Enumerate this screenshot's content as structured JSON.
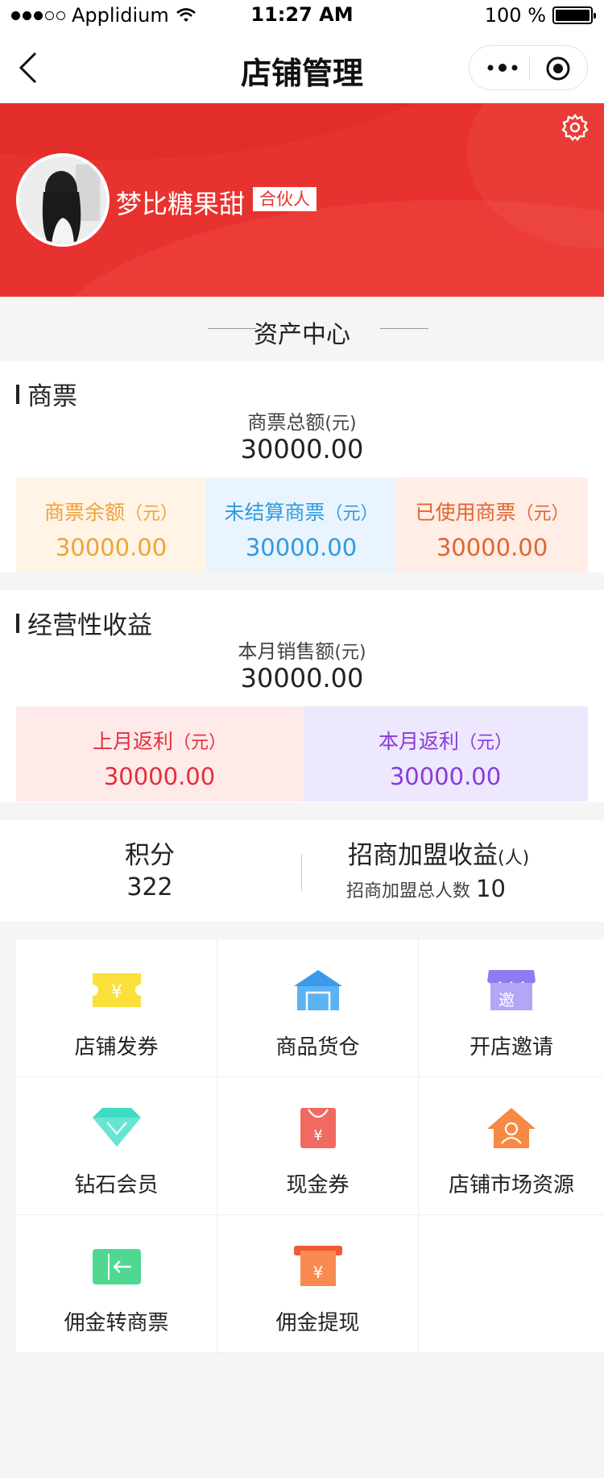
{
  "status_bar": {
    "carrier": "Applidium",
    "time": "11:27 AM",
    "battery": "100 %"
  },
  "nav": {
    "title": "店铺管理"
  },
  "profile": {
    "name": "梦比糖果甜",
    "badge": "合伙人"
  },
  "section": {
    "title": "资产中心"
  },
  "ticket": {
    "title": "商票",
    "total_label": "商票总额",
    "total_unit": "(元)",
    "total_value": "30000.00",
    "tiles": [
      {
        "label": "商票余额",
        "unit": "（元）",
        "value": "30000.00",
        "bg": "#fff4e6",
        "color": "#f0a23a"
      },
      {
        "label": "未结算商票",
        "unit": "（元）",
        "value": "30000.00",
        "bg": "#eaf4fe",
        "color": "#2f9ae0"
      },
      {
        "label": "已使用商票",
        "unit": "（元）",
        "value": "30000.00",
        "bg": "#ffede6",
        "color": "#e0662f"
      }
    ]
  },
  "income": {
    "title": "经营性收益",
    "total_label": "本月销售额",
    "total_unit": "(元)",
    "total_value": "30000.00",
    "tiles": [
      {
        "label": "上月返利",
        "unit": "（元）",
        "value": "30000.00",
        "bg": "#ffeaea",
        "color": "#e3303a"
      },
      {
        "label": "本月返利",
        "unit": "（元）",
        "value": "30000.00",
        "bg": "#ede8fe",
        "color": "#8a3ad8"
      }
    ]
  },
  "points": {
    "label": "积分",
    "value": "322",
    "invest_label": "招商加盟收益",
    "invest_unit": "(人)",
    "invest_total_label": "招商加盟总人数",
    "invest_total_value": "10"
  },
  "grid": [
    {
      "label": "店铺发券",
      "icon": "coupon-icon"
    },
    {
      "label": "商品货仓",
      "icon": "warehouse-icon"
    },
    {
      "label": "开店邀请",
      "icon": "invite-shop-icon"
    },
    {
      "label": "钻石会员",
      "icon": "diamond-icon"
    },
    {
      "label": "现金券",
      "icon": "cash-coupon-icon"
    },
    {
      "label": "店铺市场资源",
      "icon": "market-resource-icon"
    },
    {
      "label": "佣金转商票",
      "icon": "commission-transfer-icon"
    },
    {
      "label": "佣金提现",
      "icon": "withdraw-icon"
    }
  ],
  "icon_glyphs": {
    "yen": "¥",
    "invite": "邀"
  },
  "colors": {
    "banner": "#e8322f",
    "background": "#f5f5f5"
  }
}
